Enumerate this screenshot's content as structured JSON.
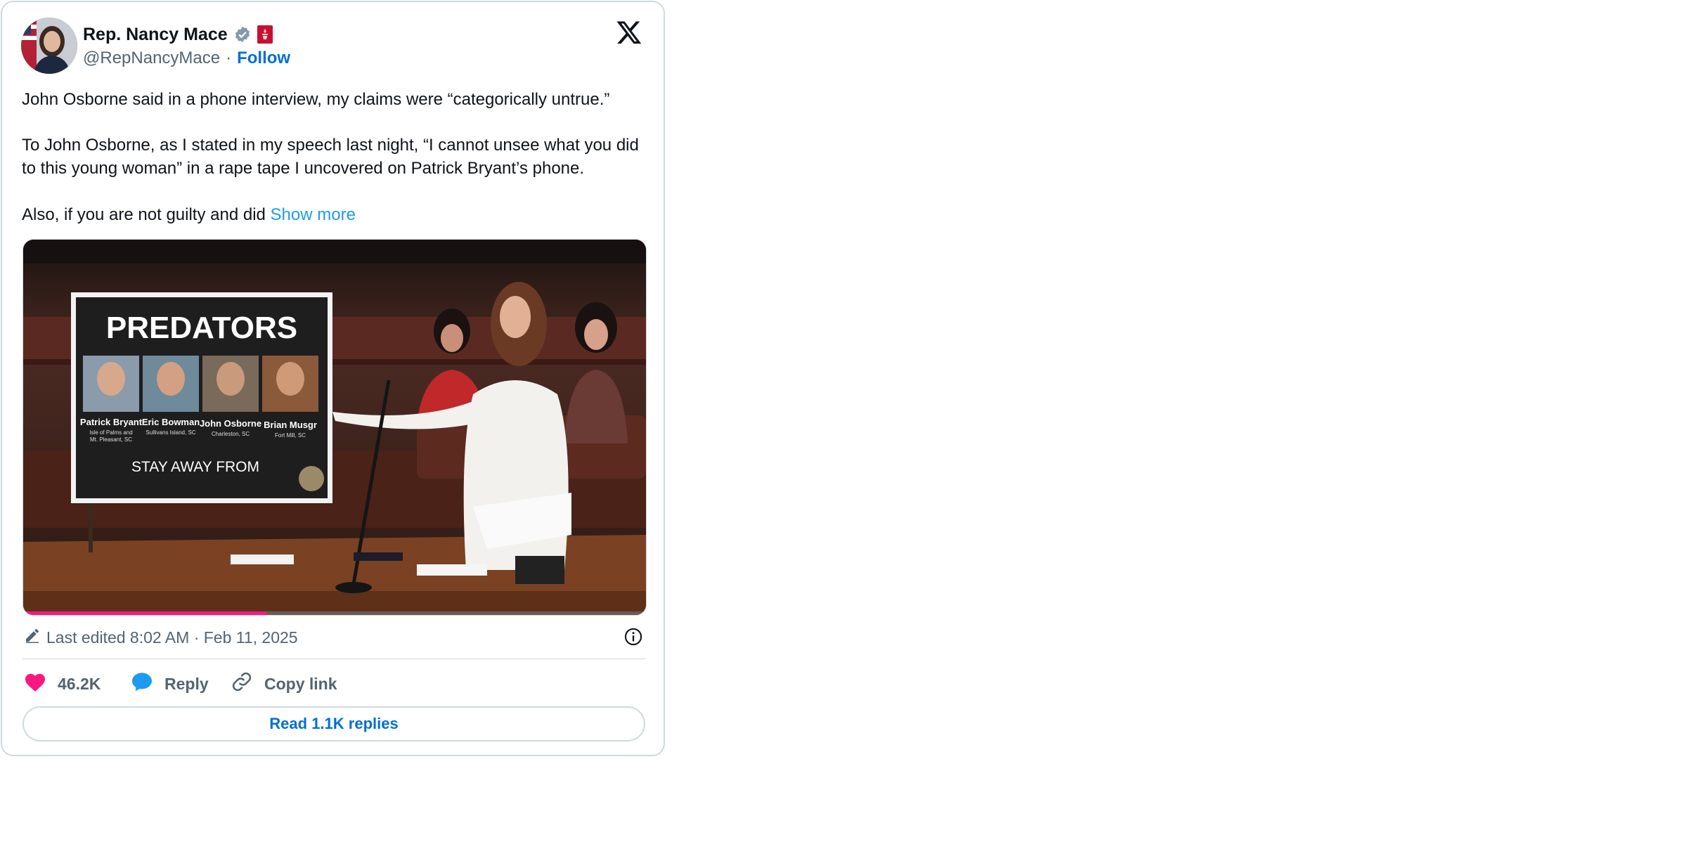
{
  "author": {
    "name": "Rep. Nancy Mace",
    "handle": "@RepNancyMace",
    "separator": "·",
    "follow_label": "Follow"
  },
  "tweet": {
    "paragraph1": "John Osborne said in a phone interview, my claims were “categorically untrue.”",
    "paragraph2": "To John Osborne, as I stated in my speech last night, “I cannot unsee what you did to this young woman” in a rape tape I uncovered on Patrick Bryant’s phone.",
    "paragraph3": "Also, if you are not guilty and did",
    "show_more": "Show more"
  },
  "media": {
    "poster_title": "PREDATORS",
    "poster_footer": "STAY AWAY FROM",
    "people": [
      {
        "name": "Patrick Bryant",
        "place_line1": "Isle of Palms and",
        "place_line2": "Mt. Pleasant, SC"
      },
      {
        "name": "Eric Bowman",
        "place_line1": "Sullivans Island, SC",
        "place_line2": ""
      },
      {
        "name": "John Osborne",
        "place_line1": "Charleston, SC",
        "place_line2": ""
      },
      {
        "name": "Brian Musgr",
        "place_line1": "Fort Mill, SC",
        "place_line2": ""
      }
    ],
    "progress": 0.39
  },
  "meta": {
    "edited": "Last edited 8:02 AM · Feb 11, 2025"
  },
  "actions": {
    "likes": "46.2K",
    "reply": "Reply",
    "copy_link": "Copy link",
    "read_replies": "Read 1.1K replies"
  },
  "colors": {
    "like": "#f91880",
    "reply": "#1d9bf0",
    "link": "#006fd6",
    "progress": "#f91880"
  },
  "icons": [
    "verified-badge-icon",
    "government-label-icon",
    "x-logo-icon",
    "pencil-icon",
    "info-icon",
    "heart-icon",
    "reply-bubble-icon",
    "link-icon"
  ]
}
